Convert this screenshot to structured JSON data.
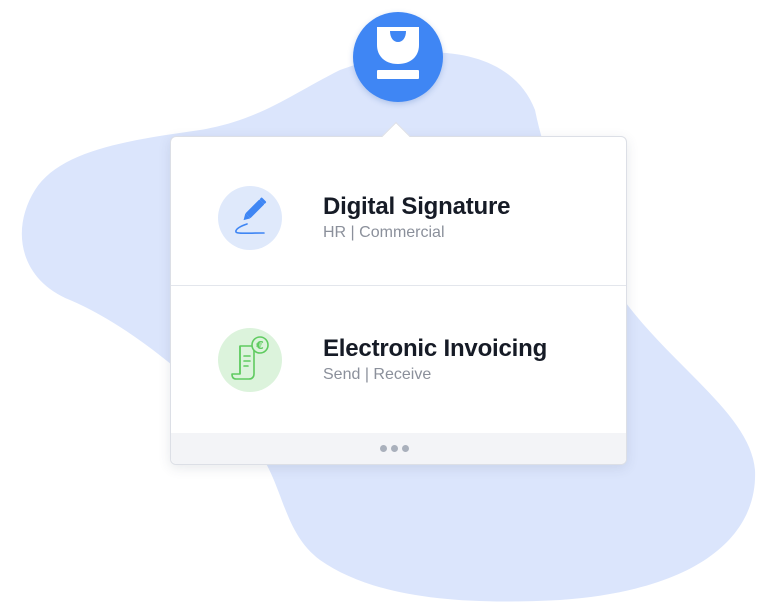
{
  "theme": {
    "blob_color": "#dbe5fc",
    "accent_color": "#3f86f4",
    "card_background": "#ffffff",
    "footer_background": "#f3f4f7"
  },
  "app_button": {
    "icon": "user-badge-icon"
  },
  "menu": {
    "items": [
      {
        "title": "Digital Signature",
        "subtitle": "HR | Commercial",
        "icon": "pen-signature-icon",
        "icon_color": "#3f86f4"
      },
      {
        "title": "Electronic Invoicing",
        "subtitle": "Send | Receive",
        "icon": "euro-invoice-icon",
        "icon_color": "#5fcb60"
      }
    ],
    "footer_icon": "more-dots-icon"
  }
}
